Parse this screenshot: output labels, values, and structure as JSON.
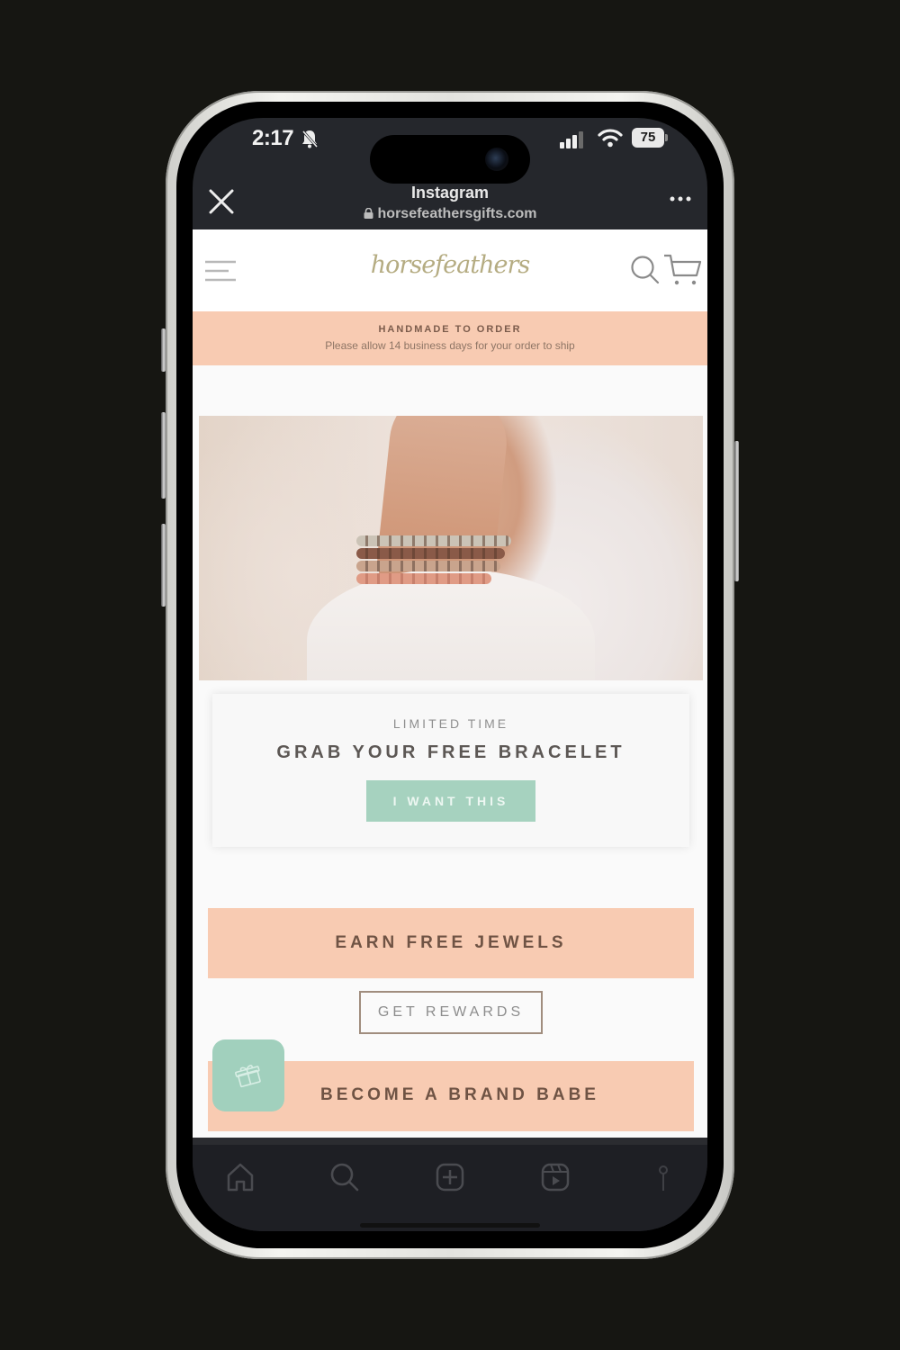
{
  "status_bar": {
    "time": "2:17",
    "battery_level": "75",
    "icons": [
      "bell-slash-icon",
      "cellular-signal-icon",
      "wifi-icon",
      "battery-icon"
    ]
  },
  "browser": {
    "title": "Instagram",
    "url": "horsefeathersgifts.com",
    "icons": {
      "close": "close-icon",
      "lock": "lock-icon",
      "more": "more-icon"
    }
  },
  "site": {
    "logo_text": "horsefeathers",
    "nav_icons": [
      "menu-icon",
      "search-icon",
      "cart-icon"
    ],
    "announcement": {
      "title": "HANDMADE TO ORDER",
      "subtitle": "Please allow 14 business days for your order to ship"
    },
    "hero": {
      "image_description": "baby foot wearing stacked beaded bracelets on a white knit blanket"
    },
    "promo": {
      "eyebrow": "LIMITED TIME",
      "title": "GRAB YOUR FREE BRACELET",
      "button_label": "I WANT THIS"
    },
    "rewards": {
      "cta_label": "EARN FREE JEWELS",
      "button_label": "GET REWARDS",
      "fab_icon": "gift-icon"
    },
    "brand_babe": {
      "cta_label": "BECOME A BRAND BABE"
    }
  },
  "instagram_nav": {
    "items": [
      "home-icon",
      "search-icon",
      "create-icon",
      "reels-icon",
      "profile-icon"
    ]
  },
  "colors": {
    "peach": "#f8cbb2",
    "mint": "#a6d2bf",
    "brown_text": "#6f5344",
    "logo_gold": "#b5ac82",
    "browser_bar": "#25272c"
  }
}
